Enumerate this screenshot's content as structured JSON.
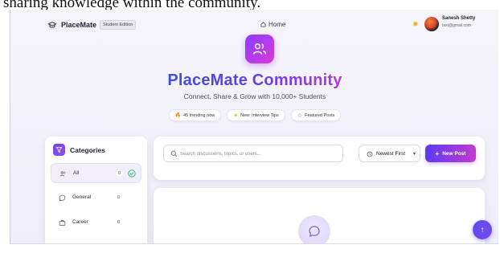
{
  "caption": "sharing knowledge within the community.",
  "topbar": {
    "logo_text": "PlaceMate",
    "edition_badge": "Student Edition",
    "home_label": "Home",
    "user_name": "Sanesh Shetty",
    "user_email": "taxt@gmail.com"
  },
  "hero": {
    "title": "PlaceMate Community",
    "subtitle": "Connect, Share & Grow with 10,000+ Students",
    "chips": [
      {
        "label": "45 trending now",
        "icon": "fire-icon"
      },
      {
        "label": "New: Interview Tips",
        "icon": "sparkle-icon"
      },
      {
        "label": "Featured Posts",
        "icon": "star-icon"
      }
    ]
  },
  "sidebar": {
    "title": "Categories",
    "items": [
      {
        "label": "All",
        "count": "0",
        "icon": "users-icon",
        "active": true
      },
      {
        "label": "General",
        "count": "0",
        "icon": "chat-icon",
        "active": false
      },
      {
        "label": "Career",
        "count": "0",
        "icon": "briefcase-icon",
        "active": false
      }
    ]
  },
  "toolbar": {
    "search_placeholder": "Search discussions, topics, or users...",
    "sort_label": "Newest First",
    "new_post_label": "New Post"
  },
  "colors": {
    "accent": "#5b3cf0",
    "accent_pink": "#c33ad0",
    "check_green": "#22b573"
  }
}
